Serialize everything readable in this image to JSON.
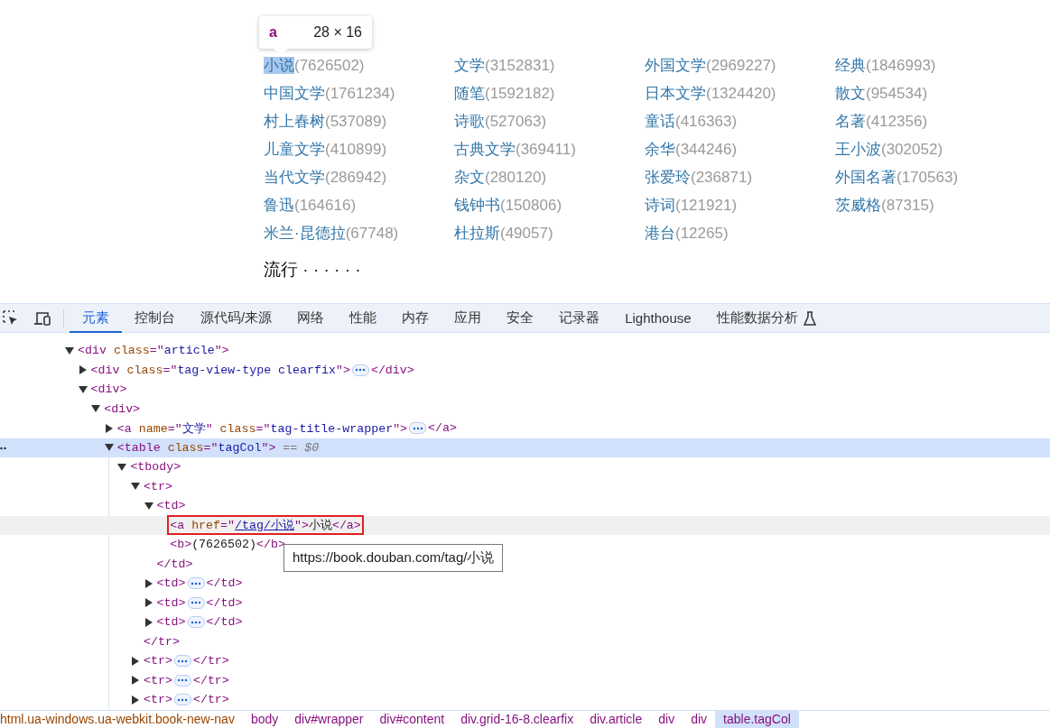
{
  "element_tooltip": {
    "tag": "a",
    "size": "28 × 16"
  },
  "tags": [
    {
      "name": "小说",
      "count": "(7626502)",
      "highlighted": true
    },
    {
      "name": "文学",
      "count": "(3152831)",
      "highlighted": false
    },
    {
      "name": "外国文学",
      "count": "(2969227)",
      "highlighted": false
    },
    {
      "name": "经典",
      "count": "(1846993)",
      "highlighted": false
    },
    {
      "name": "中国文学",
      "count": "(1761234)",
      "highlighted": false
    },
    {
      "name": "随笔",
      "count": "(1592182)",
      "highlighted": false
    },
    {
      "name": "日本文学",
      "count": "(1324420)",
      "highlighted": false
    },
    {
      "name": "散文",
      "count": "(954534)",
      "highlighted": false
    },
    {
      "name": "村上春树",
      "count": "(537089)",
      "highlighted": false
    },
    {
      "name": "诗歌",
      "count": "(527063)",
      "highlighted": false
    },
    {
      "name": "童话",
      "count": "(416363)",
      "highlighted": false
    },
    {
      "name": "名著",
      "count": "(412356)",
      "highlighted": false
    },
    {
      "name": "儿童文学",
      "count": "(410899)",
      "highlighted": false
    },
    {
      "name": "古典文学",
      "count": "(369411)",
      "highlighted": false
    },
    {
      "name": "余华",
      "count": "(344246)",
      "highlighted": false
    },
    {
      "name": "王小波",
      "count": "(302052)",
      "highlighted": false
    },
    {
      "name": "当代文学",
      "count": "(286942)",
      "highlighted": false
    },
    {
      "name": "杂文",
      "count": "(280120)",
      "highlighted": false
    },
    {
      "name": "张爱玲",
      "count": "(236871)",
      "highlighted": false
    },
    {
      "name": "外国名著",
      "count": "(170563)",
      "highlighted": false
    },
    {
      "name": "鲁迅",
      "count": "(164616)",
      "highlighted": false
    },
    {
      "name": "钱钟书",
      "count": "(150806)",
      "highlighted": false
    },
    {
      "name": "诗词",
      "count": "(121921)",
      "highlighted": false
    },
    {
      "name": "茨威格",
      "count": "(87315)",
      "highlighted": false
    },
    {
      "name": "米兰·昆德拉",
      "count": "(67748)",
      "highlighted": false
    },
    {
      "name": "杜拉斯",
      "count": "(49057)",
      "highlighted": false
    },
    {
      "name": "港台",
      "count": "(12265)",
      "highlighted": false
    }
  ],
  "section_heading": "流行 · · · · · ·",
  "devtools_tabs": [
    {
      "label": "元素",
      "selected": true,
      "experimental": false
    },
    {
      "label": "控制台",
      "selected": false,
      "experimental": false
    },
    {
      "label": "源代码/来源",
      "selected": false,
      "experimental": false
    },
    {
      "label": "网络",
      "selected": false,
      "experimental": false
    },
    {
      "label": "性能",
      "selected": false,
      "experimental": false
    },
    {
      "label": "内存",
      "selected": false,
      "experimental": false
    },
    {
      "label": "应用",
      "selected": false,
      "experimental": false
    },
    {
      "label": "安全",
      "selected": false,
      "experimental": false
    },
    {
      "label": "记录器",
      "selected": false,
      "experimental": false
    },
    {
      "label": "Lighthouse",
      "selected": false,
      "experimental": false
    },
    {
      "label": "性能数据分析",
      "selected": false,
      "experimental": true
    }
  ],
  "dom_tree": [
    {
      "tokens": [
        {
          "kind": "punct",
          "text": "<div "
        },
        {
          "kind": "attr",
          "text": "class"
        },
        {
          "kind": "punct",
          "text": "=\""
        },
        {
          "kind": "value",
          "text": "article"
        },
        {
          "kind": "punct",
          "text": "\">"
        }
      ],
      "expanded": true,
      "selected": false,
      "hovered": false,
      "outlined": false,
      "children": [
        {
          "tokens": [
            {
              "kind": "punct",
              "text": "<div "
            },
            {
              "kind": "attr",
              "text": "class"
            },
            {
              "kind": "punct",
              "text": "=\""
            },
            {
              "kind": "value",
              "text": "tag-view-type clearfix"
            },
            {
              "kind": "punct",
              "text": "\">"
            }
          ],
          "expanded": false,
          "closing": "</div>",
          "selected": false,
          "hovered": false,
          "outlined": false
        },
        {
          "tokens": [
            {
              "kind": "punct",
              "text": "<div>"
            }
          ],
          "expanded": true,
          "selected": false,
          "hovered": false,
          "outlined": false,
          "children": [
            {
              "tokens": [
                {
                  "kind": "punct",
                  "text": "<div>"
                }
              ],
              "expanded": true,
              "selected": false,
              "hovered": false,
              "outlined": false,
              "children": [
                {
                  "tokens": [
                    {
                      "kind": "punct",
                      "text": "<a "
                    },
                    {
                      "kind": "attr",
                      "text": "name"
                    },
                    {
                      "kind": "punct",
                      "text": "=\""
                    },
                    {
                      "kind": "value",
                      "text": "文学"
                    },
                    {
                      "kind": "punct",
                      "text": "\" "
                    },
                    {
                      "kind": "attr",
                      "text": "class"
                    },
                    {
                      "kind": "punct",
                      "text": "=\""
                    },
                    {
                      "kind": "value",
                      "text": "tag-title-wrapper"
                    },
                    {
                      "kind": "punct",
                      "text": "\">"
                    }
                  ],
                  "expanded": false,
                  "closing": "</a>",
                  "selected": false,
                  "hovered": false,
                  "outlined": false
                },
                {
                  "tokens": [
                    {
                      "kind": "punct",
                      "text": "<table "
                    },
                    {
                      "kind": "attr",
                      "text": "class"
                    },
                    {
                      "kind": "punct",
                      "text": "=\""
                    },
                    {
                      "kind": "value",
                      "text": "tagCol"
                    },
                    {
                      "kind": "punct",
                      "text": "\">"
                    },
                    {
                      "kind": "comment",
                      "text": " == $0"
                    }
                  ],
                  "expanded": true,
                  "selected": true,
                  "hovered": false,
                  "outlined": false,
                  "children": [
                    {
                      "tokens": [
                        {
                          "kind": "punct",
                          "text": "<tbody>"
                        }
                      ],
                      "expanded": true,
                      "selected": false,
                      "hovered": false,
                      "outlined": false,
                      "children": [
                        {
                          "tokens": [
                            {
                              "kind": "punct",
                              "text": "<tr>"
                            }
                          ],
                          "expanded": true,
                          "closing": "</tr>",
                          "selected": false,
                          "hovered": false,
                          "outlined": false,
                          "children": [
                            {
                              "tokens": [
                                {
                                  "kind": "punct",
                                  "text": "<td>"
                                }
                              ],
                              "expanded": true,
                              "closing": "</td>",
                              "selected": false,
                              "hovered": false,
                              "outlined": false,
                              "children": [
                                {
                                  "tokens": [
                                    {
                                      "kind": "punct",
                                      "text": "<a "
                                    },
                                    {
                                      "kind": "attr",
                                      "text": "href"
                                    },
                                    {
                                      "kind": "punct",
                                      "text": "=\""
                                    },
                                    {
                                      "kind": "link",
                                      "text": "/tag/小说"
                                    },
                                    {
                                      "kind": "punct",
                                      "text": "\">"
                                    },
                                    {
                                      "kind": "text",
                                      "text": "小说"
                                    },
                                    {
                                      "kind": "punct",
                                      "text": "</a>"
                                    }
                                  ],
                                  "selected": false,
                                  "hovered": true,
                                  "outlined": true
                                },
                                {
                                  "tokens": [
                                    {
                                      "kind": "punct",
                                      "text": "<b>"
                                    },
                                    {
                                      "kind": "text",
                                      "text": "(7626502)"
                                    },
                                    {
                                      "kind": "punct",
                                      "text": "</b>"
                                    }
                                  ],
                                  "selected": false,
                                  "hovered": false,
                                  "outlined": false
                                }
                              ]
                            },
                            {
                              "tokens": [
                                {
                                  "kind": "punct",
                                  "text": "<td>"
                                }
                              ],
                              "expanded": false,
                              "closing": "</td>",
                              "selected": false,
                              "hovered": false,
                              "outlined": false
                            },
                            {
                              "tokens": [
                                {
                                  "kind": "punct",
                                  "text": "<td>"
                                }
                              ],
                              "expanded": false,
                              "closing": "</td>",
                              "selected": false,
                              "hovered": false,
                              "outlined": false
                            },
                            {
                              "tokens": [
                                {
                                  "kind": "punct",
                                  "text": "<td>"
                                }
                              ],
                              "expanded": false,
                              "closing": "</td>",
                              "selected": false,
                              "hovered": false,
                              "outlined": false
                            }
                          ]
                        },
                        {
                          "tokens": [
                            {
                              "kind": "punct",
                              "text": "<tr>"
                            }
                          ],
                          "expanded": false,
                          "closing": "</tr>",
                          "selected": false,
                          "hovered": false,
                          "outlined": false
                        },
                        {
                          "tokens": [
                            {
                              "kind": "punct",
                              "text": "<tr>"
                            }
                          ],
                          "expanded": false,
                          "closing": "</tr>",
                          "selected": false,
                          "hovered": false,
                          "outlined": false
                        },
                        {
                          "tokens": [
                            {
                              "kind": "punct",
                              "text": "<tr>"
                            }
                          ],
                          "expanded": false,
                          "closing": "</tr>",
                          "selected": false,
                          "hovered": false,
                          "outlined": false
                        }
                      ]
                    }
                  ]
                }
              ]
            }
          ]
        }
      ]
    }
  ],
  "link_tooltip": "https://book.douban.com/tag/小说",
  "breadcrumbs": [
    {
      "label": "html.ua-windows.ua-webkit.book-new-nav",
      "selected": false
    },
    {
      "label": "body",
      "selected": false
    },
    {
      "label": "div#wrapper",
      "selected": false
    },
    {
      "label": "div#content",
      "selected": false
    },
    {
      "label": "div.grid-16-8.clearfix",
      "selected": false
    },
    {
      "label": "div.article",
      "selected": false
    },
    {
      "label": "div",
      "selected": false
    },
    {
      "label": "div",
      "selected": false
    },
    {
      "label": "table.tagCol",
      "selected": true
    }
  ]
}
